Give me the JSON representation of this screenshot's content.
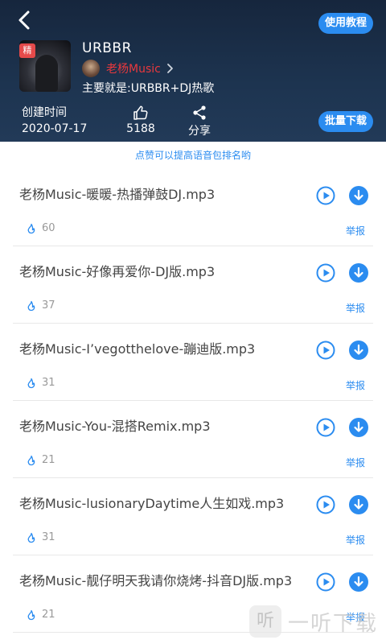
{
  "header": {
    "tutorial_label": "使用教程",
    "cover_tag": "精",
    "album_title": "URBBR",
    "author_name": "老杨Music",
    "description": "主要就是:URBBR+DJ热歌",
    "stats": {
      "created_label": "创建时间",
      "created_value": "2020-07-17",
      "likes_value": "5188",
      "share_label": "分享"
    },
    "batch_download_label": "批量下载"
  },
  "tip": "点赞可以提高语音包排名哟",
  "tracks": [
    {
      "name": "老杨Music-暖暖-热播弹鼓DJ.mp3",
      "likes": "60",
      "report": "举报"
    },
    {
      "name": "老杨Music-好像再爱你-DJ版.mp3",
      "likes": "37",
      "report": "举报"
    },
    {
      "name": "老杨Music-I’vegotthelove-蹦迪版.mp3",
      "likes": "31",
      "report": "举报"
    },
    {
      "name": "老杨Music-You-混搭Remix.mp3",
      "likes": "21",
      "report": "举报"
    },
    {
      "name": "老杨Music-lusionaryDaytime人生如戏.mp3",
      "likes": "31",
      "report": "举报"
    },
    {
      "name": "老杨Music-靓仔明天我请你烧烤-抖音DJ版.mp3",
      "likes": "21",
      "report": "举报"
    }
  ],
  "watermark": {
    "mark": "听",
    "text": "一听下载"
  },
  "colors": {
    "accent": "#2b8cf0",
    "author": "#e8383d",
    "header_bg": "#1d3450"
  }
}
